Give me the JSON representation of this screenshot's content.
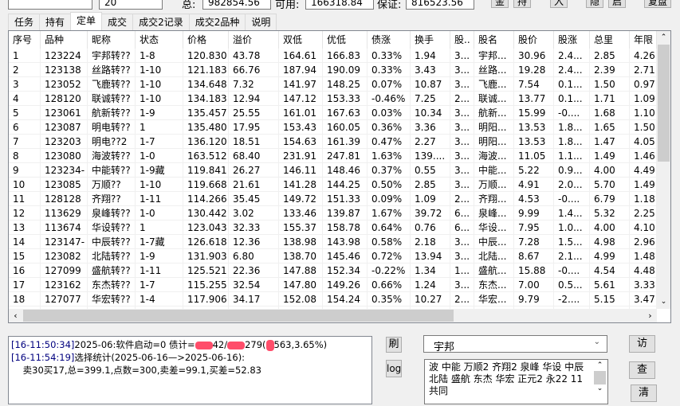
{
  "top": {
    "input1": "",
    "input2": "20",
    "total_label": "总:",
    "total_value": "982854.56",
    "avail_label": "可用:",
    "avail_value": "166318.84",
    "margin_label": "保证:",
    "margin_value": "816523.56",
    "buttons": [
      "金",
      "持",
      "入",
      "隐",
      "启",
      "复盘"
    ]
  },
  "tabs": [
    {
      "label": "任务"
    },
    {
      "label": "持有"
    },
    {
      "label": "定单",
      "active": true
    },
    {
      "label": "成交"
    },
    {
      "label": "成交2记录"
    },
    {
      "label": "成交2品种"
    },
    {
      "label": "说明"
    }
  ],
  "table": {
    "headers": [
      "序号",
      "品种",
      "昵称",
      "状态",
      "价格",
      "溢价",
      "双低",
      "优低",
      "债涨",
      "换手",
      "股..",
      "股名",
      "股价",
      "股涨",
      "总里",
      "年限"
    ],
    "rows": [
      [
        "1",
        "123224",
        "宇邦转??",
        "1-8",
        "120.830",
        "43.78",
        "164.61",
        "166.83",
        "0.33%",
        "1.94",
        "3...",
        "宇邦...",
        "30.96",
        "2.4...",
        "2.85",
        "4.26"
      ],
      [
        "2",
        "123138",
        "丝路转??",
        "1-10",
        "121.183",
        "66.76",
        "187.94",
        "190.09",
        "0.33%",
        "3.43",
        "3...",
        "丝路...",
        "19.28",
        "2.4...",
        "2.39",
        "2.71"
      ],
      [
        "3",
        "123052",
        "飞鹿转??",
        "1-10",
        "134.648",
        "7.32",
        "141.97",
        "148.25",
        "0.07%",
        "10.87",
        "3...",
        "飞鹿...",
        "7.54",
        "0.1...",
        "1.50",
        "0.97"
      ],
      [
        "4",
        "128120",
        "联诚转??",
        "1-10",
        "134.183",
        "12.94",
        "147.12",
        "153.33",
        "-0.46%",
        "7.25",
        "2...",
        "联诚...",
        "13.77",
        "0.1...",
        "1.71",
        "1.09"
      ],
      [
        "5",
        "123061",
        "航新转??",
        "1-9",
        "135.457",
        "25.55",
        "161.01",
        "167.63",
        "0.03%",
        "10.34",
        "3...",
        "航新...",
        "15.99",
        "-0....",
        "1.68",
        "1.10"
      ],
      [
        "6",
        "123087",
        "明电转??",
        "1",
        "135.480",
        "17.95",
        "153.43",
        "160.05",
        "0.36%",
        "3.36",
        "3...",
        "明阳...",
        "13.53",
        "1.8...",
        "1.65",
        "1.50"
      ],
      [
        "7",
        "123203",
        "明电??2",
        "1-7",
        "136.120",
        "18.51",
        "154.63",
        "161.39",
        "0.47%",
        "2.27",
        "3...",
        "明阳...",
        "13.53",
        "1.8...",
        "1.47",
        "4.05"
      ],
      [
        "8",
        "123080",
        "海波转??",
        "1-0",
        "163.512",
        "68.40",
        "231.91",
        "247.81",
        "1.63%",
        "139....",
        "3...",
        "海波...",
        "11.05",
        "1.1...",
        "1.49",
        "1.46"
      ],
      [
        "9",
        "123234-",
        "中能转??",
        "1-9藏",
        "119.841",
        "26.27",
        "146.11",
        "148.46",
        "0.37%",
        "0.55",
        "3...",
        "中能...",
        "5.22",
        "0.9...",
        "4.00",
        "4.49"
      ],
      [
        "10",
        "123085",
        "万顺??",
        "1-10",
        "119.668",
        "21.61",
        "141.28",
        "144.25",
        "0.50%",
        "2.85",
        "3...",
        "万顺...",
        "4.91",
        "2.0...",
        "5.70",
        "1.49"
      ],
      [
        "11",
        "128128",
        "齐翔??",
        "1-11",
        "114.266",
        "35.45",
        "149.72",
        "151.33",
        "0.09%",
        "1.09",
        "2...",
        "齐翔...",
        "4.53",
        "-0....",
        "6.79",
        "1.18"
      ],
      [
        "12",
        "113629",
        "泉峰转??",
        "1-0",
        "130.442",
        "3.02",
        "133.46",
        "139.87",
        "1.67%",
        "39.72",
        "6...",
        "泉峰...",
        "9.99",
        "1.4...",
        "5.32",
        "2.25"
      ],
      [
        "13",
        "113674",
        "华设转??",
        "1",
        "123.043",
        "32.33",
        "155.37",
        "158.78",
        "0.64%",
        "0.76",
        "6...",
        "华设...",
        "7.95",
        "1.0...",
        "4.00",
        "4.10"
      ],
      [
        "14",
        "123147-",
        "中辰转??",
        "1-7藏",
        "126.618",
        "12.36",
        "138.98",
        "143.98",
        "0.58%",
        "2.18",
        "3...",
        "中辰...",
        "7.28",
        "1.5...",
        "4.98",
        "2.96"
      ],
      [
        "15",
        "123082",
        "北陆转??",
        "1-9",
        "131.903",
        "6.80",
        "138.70",
        "145.46",
        "0.72%",
        "13.94",
        "3...",
        "北陆...",
        "8.67",
        "2.1...",
        "4.99",
        "1.48"
      ],
      [
        "16",
        "127099",
        "盛航转??",
        "1-11",
        "125.521",
        "22.36",
        "147.88",
        "152.34",
        "-0.22%",
        "1.34",
        "1...",
        "盛航...",
        "15.88",
        "-0....",
        "4.54",
        "4.48"
      ],
      [
        "17",
        "123162",
        "东杰转??",
        "1-7",
        "115.255",
        "32.54",
        "147.80",
        "149.26",
        "0.66%",
        "1.24",
        "3...",
        "东杰...",
        "7.00",
        "0.5...",
        "5.61",
        "3.33"
      ],
      [
        "18",
        "127077",
        "华宏转??",
        "1-4",
        "117.906",
        "34.17",
        "152.08",
        "154.24",
        "0.35%",
        "10.27",
        "2...",
        "华宏...",
        "9.79",
        "-2....",
        "5.15",
        "3.47"
      ]
    ]
  },
  "log": {
    "lines": [
      {
        "ts": "[16-11:50:34]",
        "a": "2025-06:软件启动=0 债计=",
        "b": "42/",
        "c": "279(",
        "d": "563,3.65%)"
      },
      {
        "ts": "[16-11:54:19]",
        "a": "选择统计(2025-06-16—>2025-06-16):"
      },
      {
        "a": "    卖30买17,总=399.1,点数=300,卖差=99.1,买差=52.83"
      }
    ]
  },
  "side": {
    "refresh_btn": "刷",
    "log_btn": "log",
    "combo_value": "宇邦",
    "visit_btn": "访",
    "query_btn": "查",
    "clear_btn": "清",
    "list_text": "波 中能 万顺2 齐翔2 泉峰 华设 中辰 北陆 盛航 东杰 华宏 正元2 永22 11 共同"
  }
}
